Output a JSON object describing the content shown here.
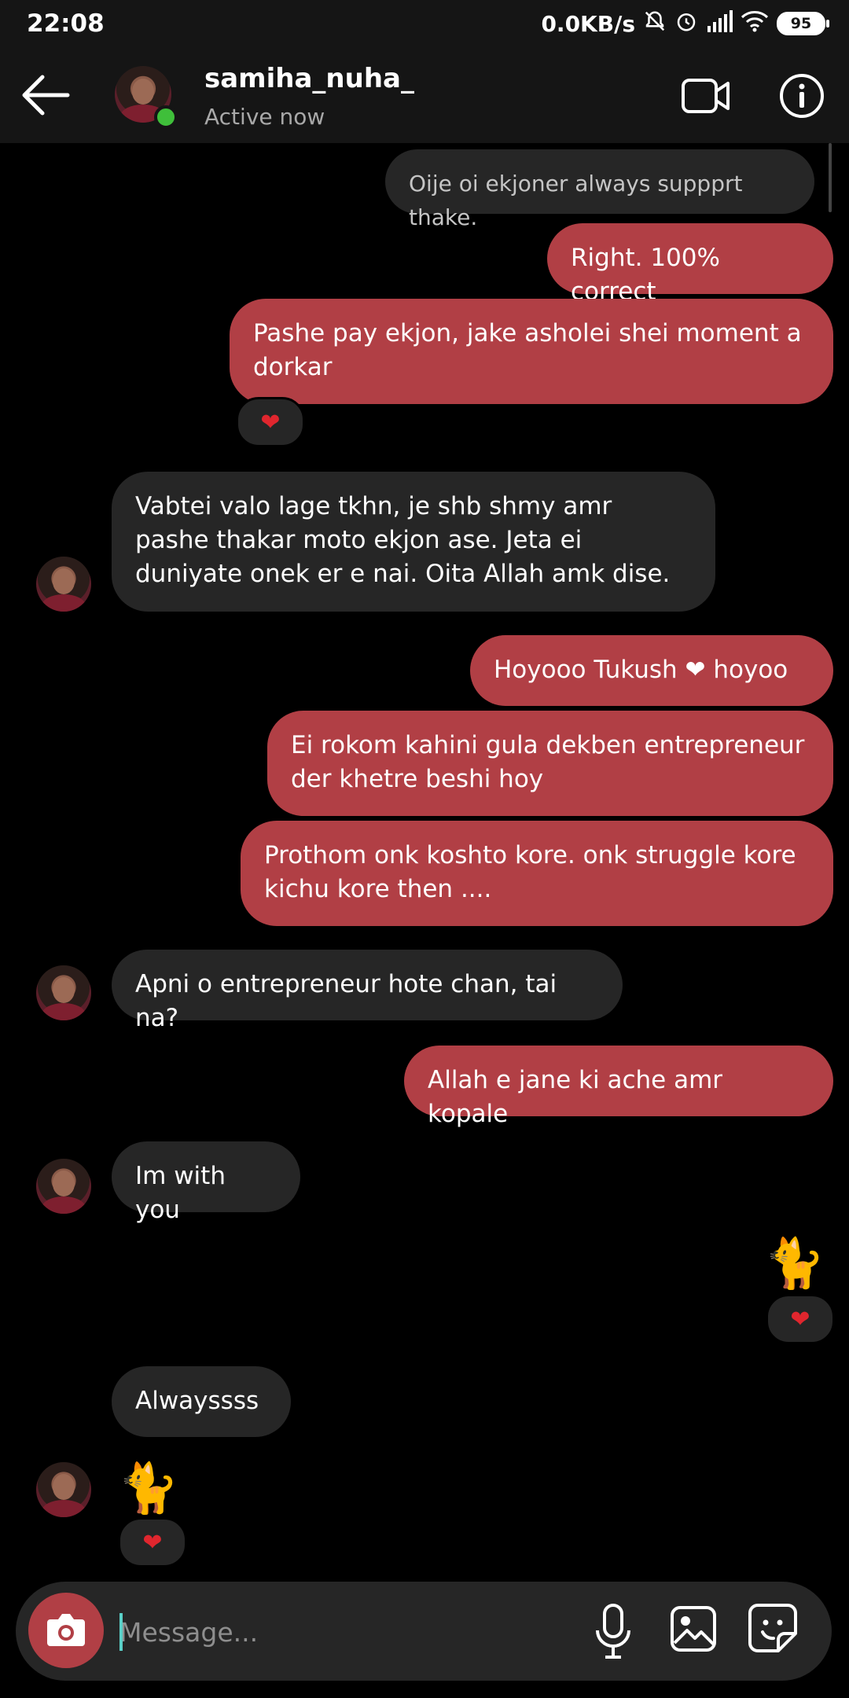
{
  "status_bar": {
    "time": "22:08",
    "network_speed": "0.0KB/s",
    "battery": "95",
    "icons": [
      "mute-bell-icon",
      "alarm-icon",
      "signal-icon",
      "wifi-icon",
      "battery-icon"
    ]
  },
  "header": {
    "username": "samiha_nuha_",
    "status": "Active now",
    "icons": [
      "back-arrow-icon",
      "video-call-icon",
      "info-icon"
    ]
  },
  "messages": [
    {
      "from": "them",
      "text": "Oije oi ekjoner always suppprt thake."
    },
    {
      "from": "me",
      "text": "Right. 100% correct"
    },
    {
      "from": "me",
      "text": "Pashe pay ekjon, jake asholei shei moment a dorkar",
      "reaction": "❤"
    },
    {
      "from": "them",
      "text": "Vabtei valo lage tkhn, je shb shmy amr pashe thakar moto ekjon ase. Jeta ei duniyate onek er e nai. Oita Allah amk dise."
    },
    {
      "from": "me",
      "text": "Hoyooo Tukush ❤ hoyoo"
    },
    {
      "from": "me",
      "text": "Ei rokom kahini gula dekben entrepreneur der khetre beshi hoy"
    },
    {
      "from": "me",
      "text": "Prothom onk koshto kore. onk struggle kore kichu kore then ...."
    },
    {
      "from": "them",
      "text": "Apni o entrepreneur hote chan, tai na?"
    },
    {
      "from": "me",
      "text": "Allah e jane ki ache amr kopale"
    },
    {
      "from": "them",
      "text": "Im with you"
    },
    {
      "from": "me",
      "sticker": "🐈",
      "reaction": "❤"
    },
    {
      "from": "them",
      "text": "Alwayssss"
    },
    {
      "from": "them",
      "sticker": "🐈",
      "reaction": "❤"
    }
  ],
  "composer": {
    "placeholder": "Message...",
    "value": "",
    "icons": [
      "camera-icon",
      "microphone-icon",
      "gallery-icon",
      "sticker-icon"
    ]
  },
  "colors": {
    "outgoing_bubble": "#b13f45",
    "incoming_bubble": "#262626",
    "online_dot": "#3fbf3a",
    "background": "#000000"
  }
}
